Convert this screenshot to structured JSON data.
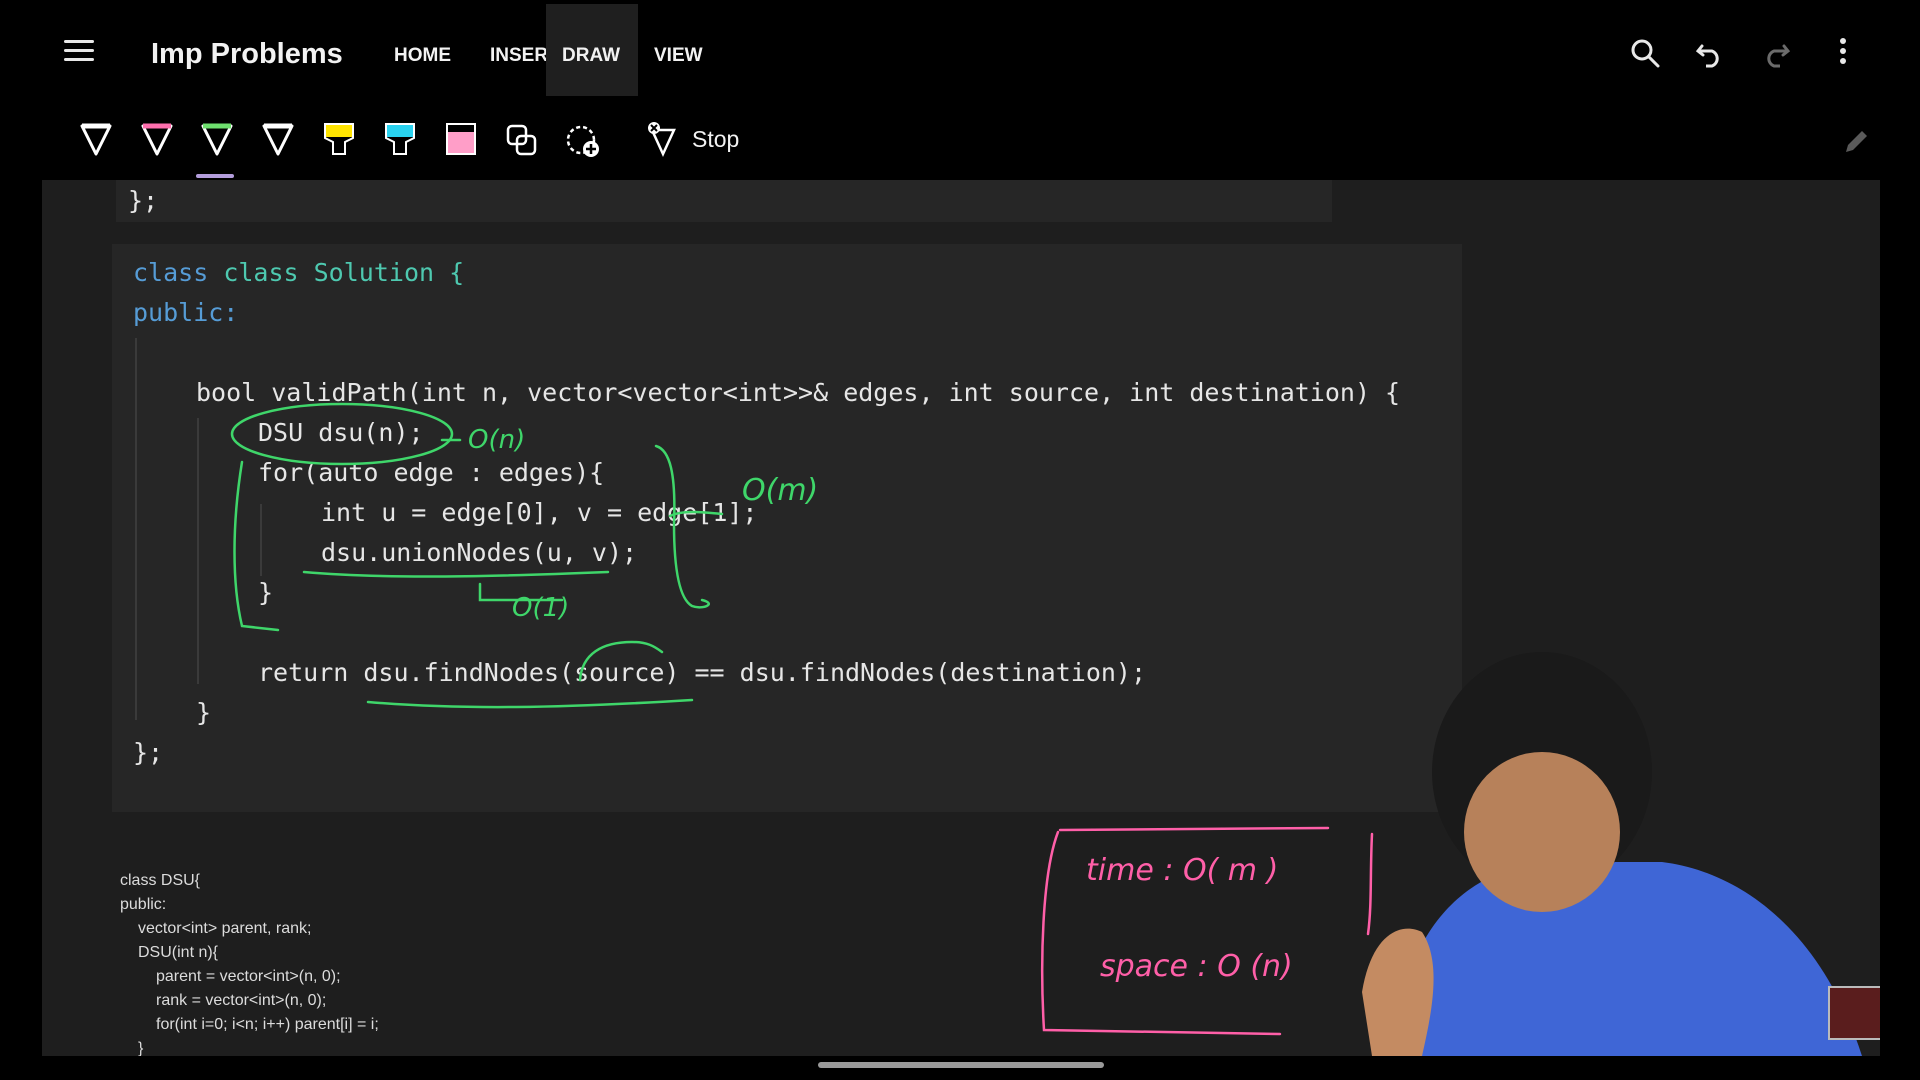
{
  "app": {
    "title": "Imp Problems",
    "tabs": [
      {
        "label": "HOME"
      },
      {
        "label": "INSERT"
      },
      {
        "label": "DRAW"
      },
      {
        "label": "VIEW"
      }
    ],
    "active_tab": "DRAW"
  },
  "toolbar": {
    "stop_label": "Stop",
    "pens": [
      {
        "name": "pen-white",
        "color": "#ffffff"
      },
      {
        "name": "pen-pink",
        "color": "#ff6fae"
      },
      {
        "name": "pen-green",
        "color": "#6ee06e"
      },
      {
        "name": "pen-white-2",
        "color": "#ffffff"
      },
      {
        "name": "highlighter-yellow",
        "color": "#ffe400"
      },
      {
        "name": "highlighter-cyan",
        "color": "#29d3f0"
      },
      {
        "name": "highlighter-pink",
        "color": "#ff9ec8"
      }
    ]
  },
  "code": {
    "top_fragment": "};",
    "lines": [
      "class Solution {",
      "public:",
      "bool validPath(int n, vector<vector<int>>& edges, int source, int destination) {",
      "DSU dsu(n);",
      "for(auto edge : edges){",
      "int u = edge[0], v = edge[1];",
      "dsu.unionNodes(u, v);",
      "}",
      "return dsu.findNodes(source) == dsu.findNodes(destination);",
      "}",
      "};"
    ]
  },
  "small_code": {
    "lines": [
      "class DSU{",
      "public:",
      "vector<int> parent, rank;",
      "DSU(int n){",
      "parent = vector<int>(n, 0);",
      "rank = vector<int>(n, 0);",
      "for(int i=0; i<n; i++) parent[i] = i;",
      "}"
    ]
  },
  "annotations": {
    "on": "O(n)",
    "om": "O(m)",
    "o1": "O(1)",
    "time": "time : O( m )",
    "space": "space : O (n)",
    "ink_green": "#3fd66a",
    "ink_pink": "#ff5fa8"
  },
  "icons": [
    "menu-icon",
    "search-icon",
    "undo-icon",
    "redo-icon",
    "more-vert-icon",
    "shape-icon",
    "lasso-add-icon",
    "stop-draw-icon",
    "edit-icon"
  ]
}
